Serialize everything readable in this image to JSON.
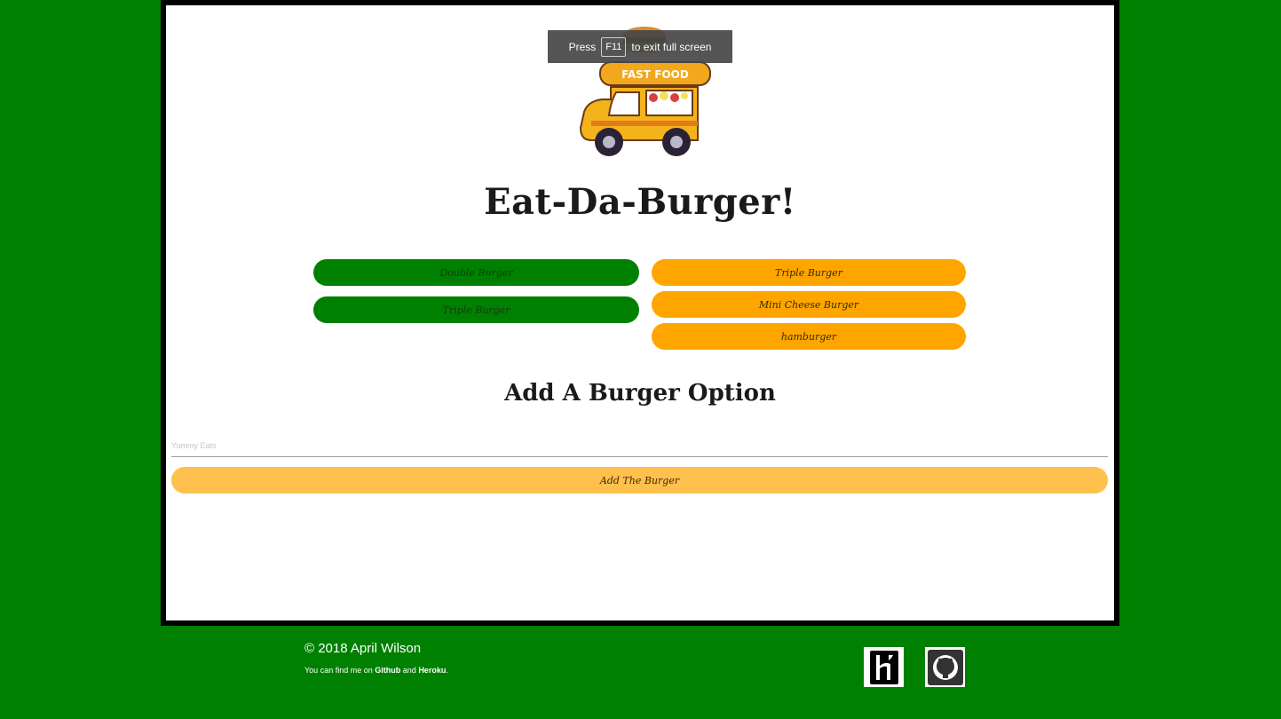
{
  "fullscreen_notice": {
    "prefix": "Press",
    "key": "F11",
    "suffix": "to exit full screen"
  },
  "header": {
    "logo_text": "FAST FOOD",
    "title": "Eat-Da-Burger!"
  },
  "burgers": {
    "devoured": [
      {
        "label": "Double Burger"
      },
      {
        "label": "Triple Burger"
      }
    ],
    "available": [
      {
        "label": "Triple Burger"
      },
      {
        "label": "Mini Cheese Burger"
      },
      {
        "label": "hamburger"
      }
    ]
  },
  "add_form": {
    "heading": "Add A Burger Option",
    "input_value": "",
    "input_placeholder": "Yummy Eats",
    "button_label": "Add The Burger"
  },
  "footer": {
    "copyright": "© 2018 April Wilson",
    "note_prefix": "You can find me on",
    "github_link": "Github",
    "note_and": "and",
    "heroku_link": "Heroku",
    "note_suffix": "."
  },
  "colors": {
    "background": "#008000",
    "devoured_button": "#008000",
    "available_button": "#ffa500",
    "add_button": "#ffc04d"
  },
  "icons": {
    "heroku": "heroku-icon",
    "github": "github-icon"
  }
}
